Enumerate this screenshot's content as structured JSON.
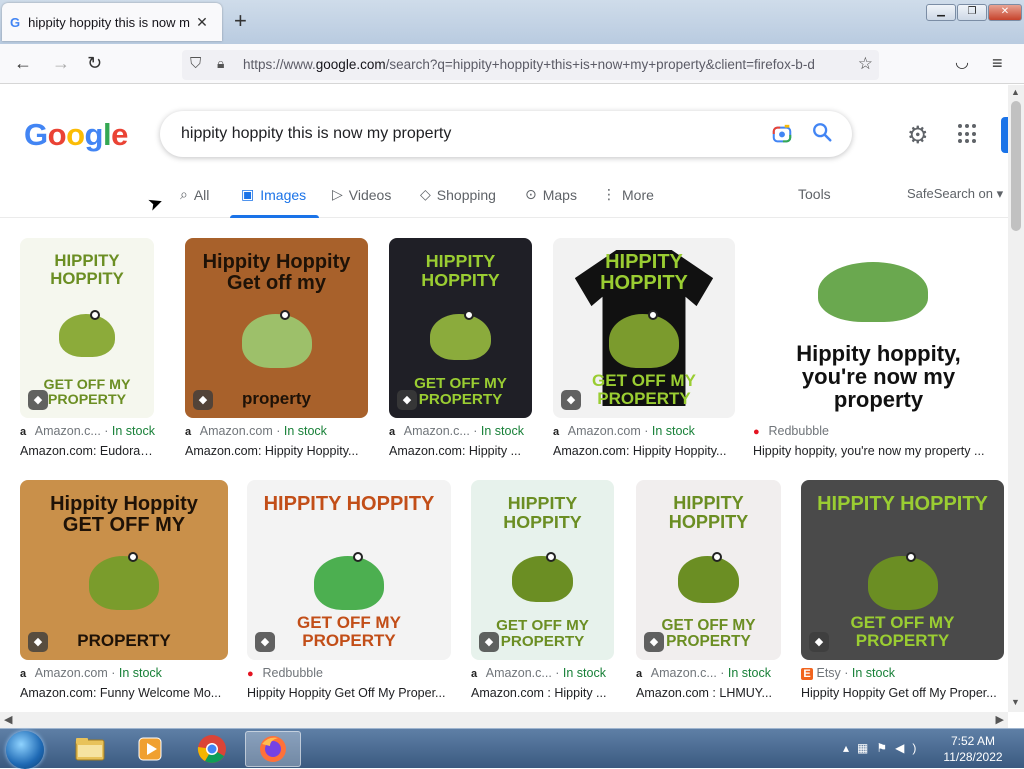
{
  "browser": {
    "tab_title": "hippity hoppity this is now my p",
    "tab_close": "✕",
    "new_tab": "+",
    "url_prefix": "https://www.",
    "url_domain": "google.com",
    "url_rest": "/search?q=hippity+hoppity+this+is+now+my+property&client=firefox-b-d",
    "win_min": "▁",
    "win_max": "❐",
    "win_close": "✕"
  },
  "google": {
    "logo": [
      "G",
      "o",
      "o",
      "g",
      "l",
      "e"
    ],
    "query": "hippity hoppity this is now my property"
  },
  "tabs": {
    "all": "All",
    "images": "Images",
    "videos": "Videos",
    "shopping": "Shopping",
    "maps": "Maps",
    "more": "More",
    "tools": "Tools",
    "safesearch": "SafeSearch on ▾"
  },
  "results": [
    {
      "source": "Amazon.c...",
      "stock": "In stock",
      "caption": "Amazon.com: Eudora ...",
      "fav": "a",
      "thumb_text": [
        "HIPPITY HOPPITY",
        "GET OFF MY PROPERTY"
      ]
    },
    {
      "source": "Amazon.com",
      "stock": "In stock",
      "caption": "Amazon.com: Hippity Hoppity...",
      "fav": "a",
      "thumb_text": [
        "Hippity Hoppity Get off my",
        "property"
      ]
    },
    {
      "source": "Amazon.c...",
      "stock": "In stock",
      "caption": "Amazon.com: Hippity ...",
      "fav": "a",
      "thumb_text": [
        "HIPPITY HOPPITY",
        "GET OFF MY PROPERTY"
      ]
    },
    {
      "source": "Amazon.com",
      "stock": "In stock",
      "caption": "Amazon.com: Hippity Hoppity...",
      "fav": "a",
      "thumb_text": [
        "HIPPITY HOPPITY",
        "GET OFF MY PROPERTY"
      ]
    },
    {
      "source": "Redbubble",
      "stock": "",
      "caption": "Hippity hoppity, you're now my property ...",
      "fav": "●",
      "thumb_text": [
        "Hippity hoppity, you're now my property",
        ""
      ]
    },
    {
      "source": "Amazon.com",
      "stock": "In stock",
      "caption": "Amazon.com: Funny Welcome Mo...",
      "fav": "a",
      "thumb_text": [
        "Hippity Hoppity GET OFF MY",
        "PROPERTY"
      ]
    },
    {
      "source": "Redbubble",
      "stock": "",
      "caption": "Hippity Hoppity Get Off My Proper...",
      "fav": "●",
      "thumb_text": [
        "HIPPITY HOPPITY",
        "GET OFF MY PROPERTY"
      ]
    },
    {
      "source": "Amazon.c...",
      "stock": "In stock",
      "caption": "Amazon.com : Hippity ...",
      "fav": "a",
      "thumb_text": [
        "HIPPITY HOPPITY",
        "GET OFF MY PROPERTY"
      ]
    },
    {
      "source": "Amazon.c...",
      "stock": "In stock",
      "caption": "Amazon.com : LHMUY...",
      "fav": "a",
      "thumb_text": [
        "HIPPITY HOPPITY",
        "GET OFF MY PROPERTY"
      ]
    },
    {
      "source": "Etsy",
      "stock": "In stock",
      "caption": "Hippity Hoppity Get off My Proper...",
      "fav": "E",
      "thumb_text": [
        "HIPPITY HOPPITY",
        "GET OFF MY PROPERTY"
      ]
    }
  ],
  "taskbar": {
    "time": "7:52 AM",
    "date": "11/28/2022"
  },
  "colors": {
    "accent": "#1a73e8",
    "in_stock": "#188038"
  }
}
